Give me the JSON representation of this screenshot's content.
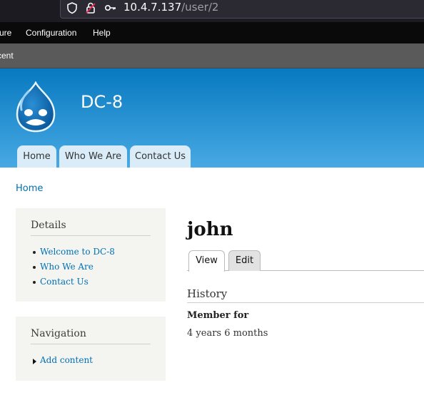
{
  "browser": {
    "url_host": "10.4.7.137",
    "url_path": "/user/2",
    "icons": [
      "shield-icon",
      "lock-warning-icon",
      "key-icon"
    ]
  },
  "toolbar": {
    "items": [
      "ure",
      "Configuration",
      "Help"
    ]
  },
  "shortcuts": {
    "label": "cent"
  },
  "header": {
    "site_name": "DC-8",
    "tabs": [
      "Home",
      "Who We Are",
      "Contact Us"
    ],
    "colors": {
      "gradient_top": "#0779bf",
      "gradient_bottom": "#48a9e4"
    }
  },
  "breadcrumb": {
    "home": "Home"
  },
  "sidebar": {
    "details": {
      "title": "Details",
      "links": [
        "Welcome to DC-8",
        "Who We Are",
        "Contact Us"
      ]
    },
    "navigation": {
      "title": "Navigation",
      "links": [
        "Add content"
      ]
    }
  },
  "main": {
    "title": "john",
    "tabs": [
      "View",
      "Edit"
    ],
    "history": {
      "heading": "History",
      "member_label": "Member for",
      "member_value": "4 years 6 months"
    }
  },
  "colors": {
    "link": "#0071b3",
    "toolbar": "#0a0a0a"
  }
}
